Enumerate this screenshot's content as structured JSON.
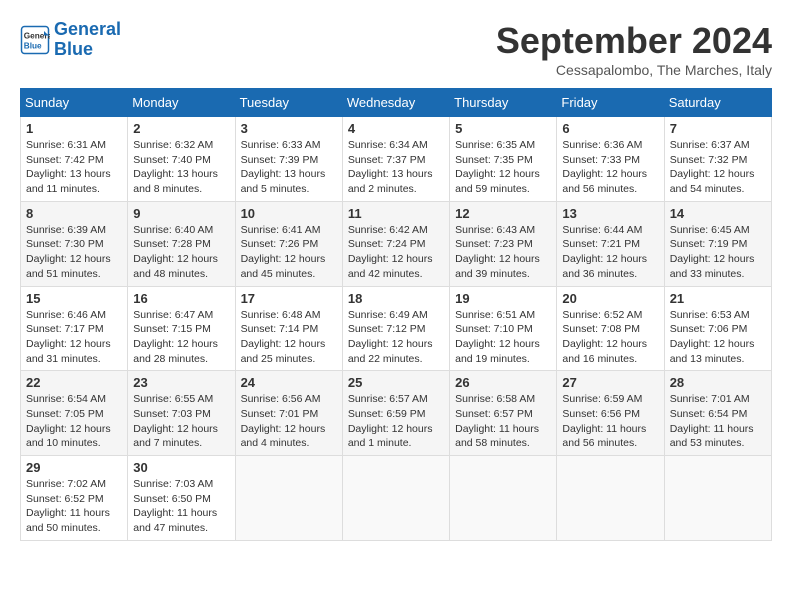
{
  "logo": {
    "line1": "General",
    "line2": "Blue"
  },
  "title": "September 2024",
  "location": "Cessapalombo, The Marches, Italy",
  "weekdays": [
    "Sunday",
    "Monday",
    "Tuesday",
    "Wednesday",
    "Thursday",
    "Friday",
    "Saturday"
  ],
  "weeks": [
    [
      {
        "day": "1",
        "sunrise": "6:31 AM",
        "sunset": "7:42 PM",
        "daylight": "13 hours and 11 minutes."
      },
      {
        "day": "2",
        "sunrise": "6:32 AM",
        "sunset": "7:40 PM",
        "daylight": "13 hours and 8 minutes."
      },
      {
        "day": "3",
        "sunrise": "6:33 AM",
        "sunset": "7:39 PM",
        "daylight": "13 hours and 5 minutes."
      },
      {
        "day": "4",
        "sunrise": "6:34 AM",
        "sunset": "7:37 PM",
        "daylight": "13 hours and 2 minutes."
      },
      {
        "day": "5",
        "sunrise": "6:35 AM",
        "sunset": "7:35 PM",
        "daylight": "12 hours and 59 minutes."
      },
      {
        "day": "6",
        "sunrise": "6:36 AM",
        "sunset": "7:33 PM",
        "daylight": "12 hours and 56 minutes."
      },
      {
        "day": "7",
        "sunrise": "6:37 AM",
        "sunset": "7:32 PM",
        "daylight": "12 hours and 54 minutes."
      }
    ],
    [
      {
        "day": "8",
        "sunrise": "6:39 AM",
        "sunset": "7:30 PM",
        "daylight": "12 hours and 51 minutes."
      },
      {
        "day": "9",
        "sunrise": "6:40 AM",
        "sunset": "7:28 PM",
        "daylight": "12 hours and 48 minutes."
      },
      {
        "day": "10",
        "sunrise": "6:41 AM",
        "sunset": "7:26 PM",
        "daylight": "12 hours and 45 minutes."
      },
      {
        "day": "11",
        "sunrise": "6:42 AM",
        "sunset": "7:24 PM",
        "daylight": "12 hours and 42 minutes."
      },
      {
        "day": "12",
        "sunrise": "6:43 AM",
        "sunset": "7:23 PM",
        "daylight": "12 hours and 39 minutes."
      },
      {
        "day": "13",
        "sunrise": "6:44 AM",
        "sunset": "7:21 PM",
        "daylight": "12 hours and 36 minutes."
      },
      {
        "day": "14",
        "sunrise": "6:45 AM",
        "sunset": "7:19 PM",
        "daylight": "12 hours and 33 minutes."
      }
    ],
    [
      {
        "day": "15",
        "sunrise": "6:46 AM",
        "sunset": "7:17 PM",
        "daylight": "12 hours and 31 minutes."
      },
      {
        "day": "16",
        "sunrise": "6:47 AM",
        "sunset": "7:15 PM",
        "daylight": "12 hours and 28 minutes."
      },
      {
        "day": "17",
        "sunrise": "6:48 AM",
        "sunset": "7:14 PM",
        "daylight": "12 hours and 25 minutes."
      },
      {
        "day": "18",
        "sunrise": "6:49 AM",
        "sunset": "7:12 PM",
        "daylight": "12 hours and 22 minutes."
      },
      {
        "day": "19",
        "sunrise": "6:51 AM",
        "sunset": "7:10 PM",
        "daylight": "12 hours and 19 minutes."
      },
      {
        "day": "20",
        "sunrise": "6:52 AM",
        "sunset": "7:08 PM",
        "daylight": "12 hours and 16 minutes."
      },
      {
        "day": "21",
        "sunrise": "6:53 AM",
        "sunset": "7:06 PM",
        "daylight": "12 hours and 13 minutes."
      }
    ],
    [
      {
        "day": "22",
        "sunrise": "6:54 AM",
        "sunset": "7:05 PM",
        "daylight": "12 hours and 10 minutes."
      },
      {
        "day": "23",
        "sunrise": "6:55 AM",
        "sunset": "7:03 PM",
        "daylight": "12 hours and 7 minutes."
      },
      {
        "day": "24",
        "sunrise": "6:56 AM",
        "sunset": "7:01 PM",
        "daylight": "12 hours and 4 minutes."
      },
      {
        "day": "25",
        "sunrise": "6:57 AM",
        "sunset": "6:59 PM",
        "daylight": "12 hours and 1 minute."
      },
      {
        "day": "26",
        "sunrise": "6:58 AM",
        "sunset": "6:57 PM",
        "daylight": "11 hours and 58 minutes."
      },
      {
        "day": "27",
        "sunrise": "6:59 AM",
        "sunset": "6:56 PM",
        "daylight": "11 hours and 56 minutes."
      },
      {
        "day": "28",
        "sunrise": "7:01 AM",
        "sunset": "6:54 PM",
        "daylight": "11 hours and 53 minutes."
      }
    ],
    [
      {
        "day": "29",
        "sunrise": "7:02 AM",
        "sunset": "6:52 PM",
        "daylight": "11 hours and 50 minutes."
      },
      {
        "day": "30",
        "sunrise": "7:03 AM",
        "sunset": "6:50 PM",
        "daylight": "11 hours and 47 minutes."
      },
      null,
      null,
      null,
      null,
      null
    ]
  ]
}
